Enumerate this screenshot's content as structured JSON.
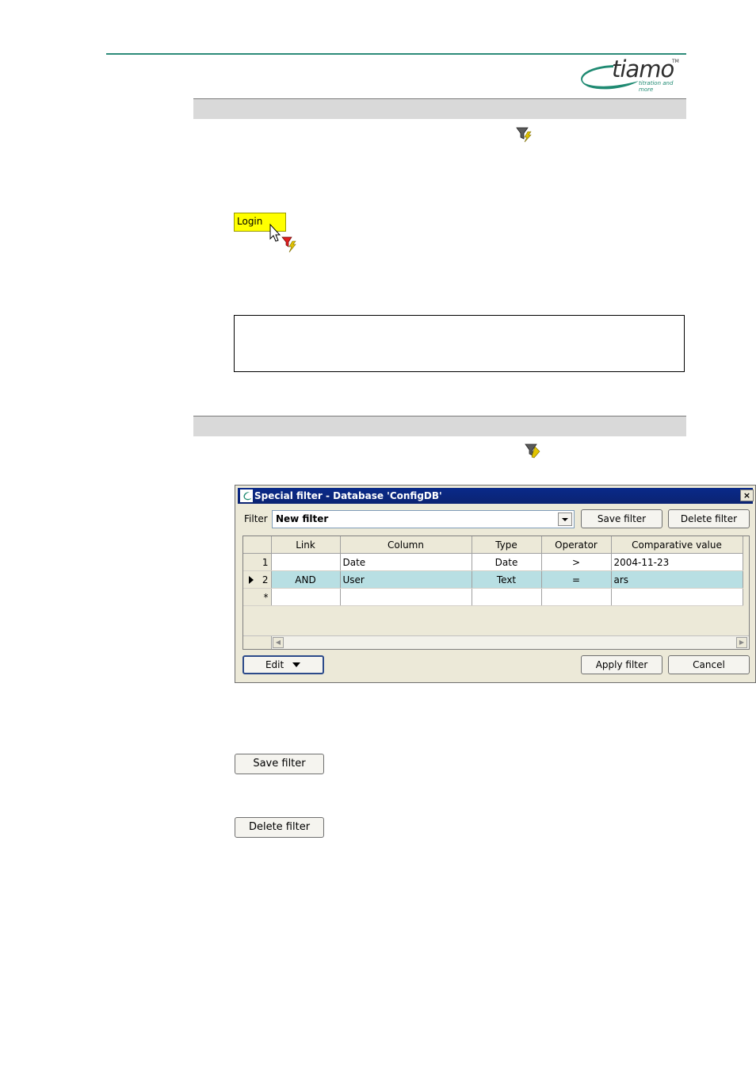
{
  "logo": {
    "word": "tiamo",
    "tm": "TM",
    "tagline": "titration and more"
  },
  "login_button": {
    "label": "Login"
  },
  "dialog": {
    "title": "Special filter - Database 'ConfigDB'",
    "close": "×",
    "filter_label": "Filter",
    "filter_value": "New filter",
    "save_filter": "Save filter",
    "delete_filter": "Delete filter",
    "columns": [
      "Link",
      "Column",
      "Type",
      "Operator",
      "Comparative value"
    ],
    "rows": [
      {
        "num": "1",
        "link": "",
        "column": "Date",
        "type": "Date",
        "operator": ">",
        "value": "2004-11-23",
        "selected": false
      },
      {
        "num": "2",
        "link": "AND",
        "column": "User",
        "type": "Text",
        "operator": "=",
        "value": "ars",
        "selected": true
      },
      {
        "num": "*",
        "link": "",
        "column": "",
        "type": "",
        "operator": "",
        "value": "",
        "selected": false
      }
    ],
    "edit": "Edit",
    "apply_filter": "Apply filter",
    "cancel": "Cancel"
  },
  "standalone_buttons": {
    "save_filter": "Save filter",
    "delete_filter": "Delete filter"
  },
  "colors": {
    "accent_line": "#2e8b7a",
    "title_bar": "#0a2a8a",
    "selected_row": "#b8dfe3",
    "login_highlight": "#ffff00"
  }
}
